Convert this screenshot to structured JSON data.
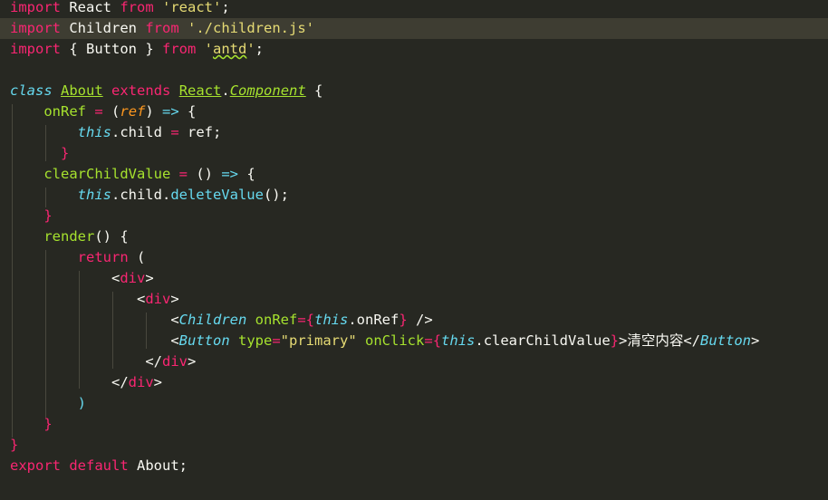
{
  "colors": {
    "background": "#272822",
    "current_line": "#3e3d32",
    "keyword": "#f92672",
    "storage": "#66d9ef",
    "string": "#e6db74",
    "function": "#a6e22e",
    "parameter": "#fd971f",
    "text": "#f8f8f2"
  },
  "code": {
    "l1": {
      "t1": "import",
      "t2": " React ",
      "t3": "from",
      "t4": " ",
      "t5": "'react'",
      "t6": ";"
    },
    "l2": {
      "t1": "import",
      "t2": " Children ",
      "t3": "from",
      "t4": " ",
      "t5": "'./children.js'"
    },
    "l3": {
      "t1": "import",
      "t2": " { Button } ",
      "t3": "from",
      "t4": " ",
      "t5": "'",
      "t6": "antd",
      "t7": "'",
      "t8": ";"
    },
    "l4": {},
    "l5": {
      "t1": "class",
      "t2": " ",
      "t3": "About",
      "t4": " ",
      "t5": "extends",
      "t6": " ",
      "t7": "React",
      "t8": ".",
      "t9": "Component",
      "t10": " {"
    },
    "l6": {
      "t1": "onRef",
      "t2": " ",
      "t3": "=",
      "t4": " (",
      "t5": "ref",
      "t6": ") ",
      "t7": "=>",
      "t8": " {"
    },
    "l7": {
      "t1": "this",
      "t2": ".child ",
      "t3": "=",
      "t4": " ref;"
    },
    "l8": {
      "t1": "}"
    },
    "l9": {
      "t1": "clearChildValue",
      "t2": " ",
      "t3": "=",
      "t4": " () ",
      "t5": "=>",
      "t6": " {"
    },
    "l10": {
      "t1": "this",
      "t2": ".child.",
      "t3": "deleteValue",
      "t4": "();"
    },
    "l11": {
      "t1": "}"
    },
    "l12": {
      "t1": "render",
      "t2": "() {"
    },
    "l13": {
      "t1": "return",
      "t2": " ("
    },
    "l14": {
      "t1": "<",
      "t2": "div",
      "t3": ">"
    },
    "l15": {
      "t1": "<",
      "t2": "div",
      "t3": ">"
    },
    "l16": {
      "t1": "<",
      "t2": "Children",
      "t3": " ",
      "t4": "onRef",
      "t5": "=",
      "t6": "{",
      "t7": "this",
      "t8": ".onRef",
      "t9": "}",
      "t10": " />"
    },
    "l17": {
      "t1": "<",
      "t2": "Button",
      "t3": " ",
      "t4": "type",
      "t5": "=",
      "t6": "\"primary\"",
      "t7": " ",
      "t8": "onClick",
      "t9": "=",
      "t10": "{",
      "t11": "this",
      "t12": ".clearChildValue",
      "t13": "}",
      "t14": ">清空内容</",
      "t15": "Button",
      "t16": ">"
    },
    "l18": {
      "t1": "</",
      "t2": "div",
      "t3": ">"
    },
    "l19": {
      "t1": "</",
      "t2": "div",
      "t3": ">"
    },
    "l20": {
      "t1": ")"
    },
    "l21": {
      "t1": "}"
    },
    "l22": {
      "t1": "}"
    },
    "l23": {
      "t1": "export",
      "t2": " ",
      "t3": "default",
      "t4": " About;"
    }
  }
}
